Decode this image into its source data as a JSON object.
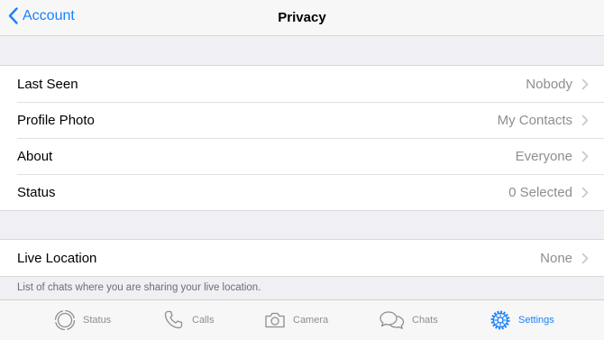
{
  "nav": {
    "back_label": "Account",
    "title": "Privacy"
  },
  "privacy_rows": [
    {
      "label": "Last Seen",
      "value": "Nobody"
    },
    {
      "label": "Profile Photo",
      "value": "My Contacts"
    },
    {
      "label": "About",
      "value": "Everyone"
    },
    {
      "label": "Status",
      "value": "0 Selected"
    }
  ],
  "live_location": {
    "label": "Live Location",
    "value": "None",
    "footnote": "List of chats where you are sharing your live location."
  },
  "tabbar": {
    "tabs": [
      {
        "label": "Status",
        "icon": "status-icon"
      },
      {
        "label": "Calls",
        "icon": "phone-icon"
      },
      {
        "label": "Camera",
        "icon": "camera-icon"
      },
      {
        "label": "Chats",
        "icon": "chat-bubbles-icon"
      },
      {
        "label": "Settings",
        "icon": "gear-icon",
        "active": true
      }
    ]
  },
  "colors": {
    "accent": "#1a82fb",
    "inactive": "#8e8e93",
    "background": "#efeff4"
  }
}
